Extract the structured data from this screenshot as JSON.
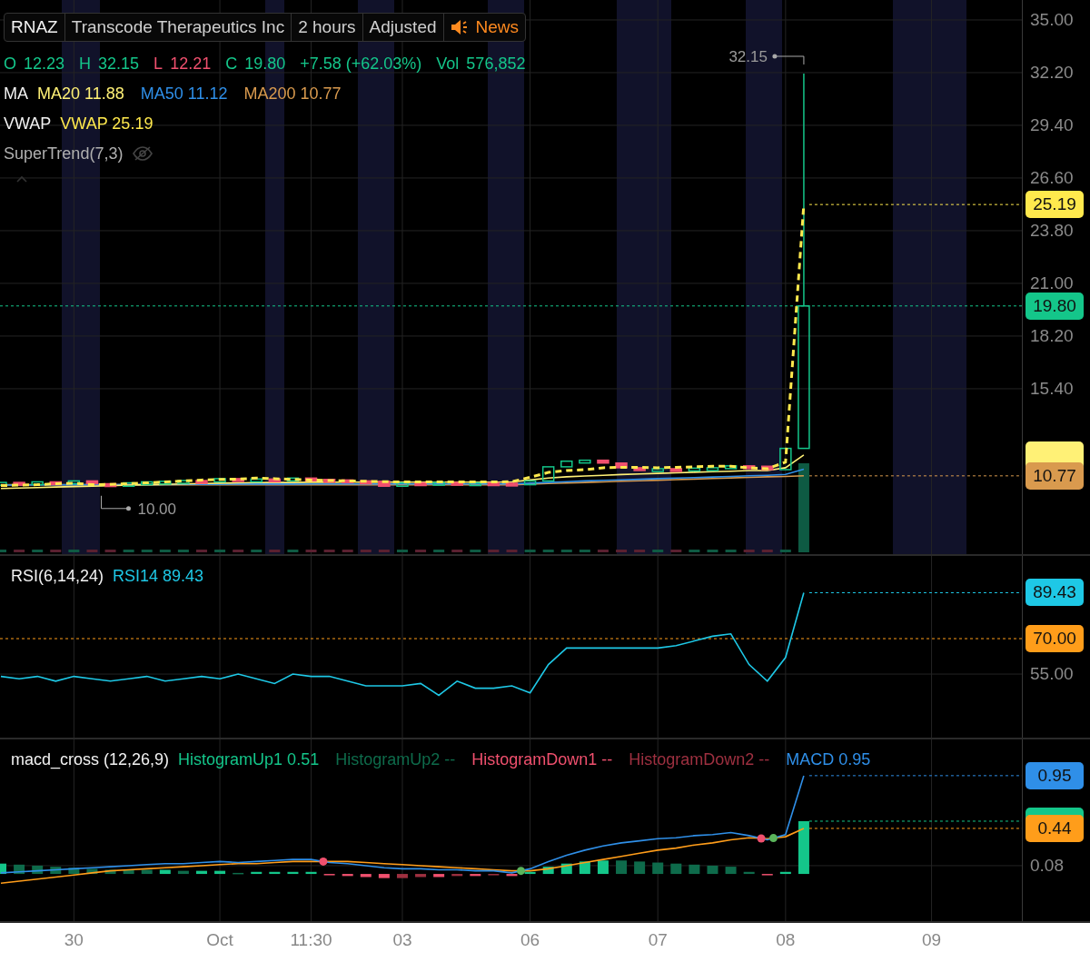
{
  "header": {
    "symbol": "RNAZ",
    "name": "Transcode Therapeutics Inc",
    "interval": "2 hours",
    "adjustment": "Adjusted",
    "news": "News"
  },
  "quote": [
    {
      "label": "O",
      "value": "12.23",
      "color": "#14c68a"
    },
    {
      "label": "H",
      "value": "32.15",
      "color": "#14c68a"
    },
    {
      "label": "L",
      "value": "12.21",
      "color": "#f0506e"
    },
    {
      "label": "C",
      "value": "19.80",
      "color": "#14c68a"
    },
    {
      "value": "+7.58 (+62.03%)",
      "color": "#14c68a"
    },
    {
      "label": "Vol",
      "value": "576,852",
      "color": "#14c68a"
    }
  ],
  "studies": [
    {
      "name": "MA",
      "visible": true,
      "values": [
        {
          "text": "MA20 11.88",
          "color": "#fff176"
        },
        {
          "text": "MA50 11.12",
          "color": "#2f8fe8"
        },
        {
          "text": "MA200 10.77",
          "color": "#d99a4e"
        }
      ]
    },
    {
      "name": "VWAP",
      "visible": true,
      "values": [
        {
          "text": "VWAP 25.19",
          "color": "#ffe94d"
        }
      ]
    },
    {
      "name": "SuperTrend(7,3)",
      "visible": false
    }
  ],
  "price_pane": {
    "annotations": [
      "32.15",
      "10.00"
    ],
    "axis_labels": [
      "35.00",
      "32.20",
      "29.40",
      "26.60",
      "23.80",
      "21.00",
      "18.20",
      "15.40"
    ],
    "price_tags": [
      {
        "value": "25.19",
        "kind": "last",
        "color": "#ffe94d"
      },
      {
        "value": "19.80",
        "kind": "level",
        "color": "#14c68a"
      },
      {
        "value": "10.77",
        "kind": "last",
        "color": "#d99a4e"
      }
    ]
  },
  "rsi_pane": {
    "title": "RSI(6,14,24)",
    "legend": {
      "text": "RSI14 89.43",
      "color": "#1ec8e6"
    },
    "axis_labels": [
      "55.00"
    ],
    "tags": [
      {
        "value": "89.43",
        "kind": "last",
        "color": "#1ec8e6"
      },
      {
        "value": "70.00",
        "kind": "level",
        "color": "#ff9d1a"
      }
    ]
  },
  "macd_pane": {
    "title": "macd_cross (12,26,9)",
    "legend": [
      {
        "text": "HistogramUp1 0.51",
        "color": "#14c68a"
      },
      {
        "text": "HistogramUp2 --",
        "color": "#0e6b4b"
      },
      {
        "text": "HistogramDown1 --",
        "color": "#f0506e"
      },
      {
        "text": "HistogramDown2 --",
        "color": "#9e3040"
      },
      {
        "text": "MACD 0.95",
        "color": "#2f8fe8"
      }
    ],
    "axis_labels": [
      "0.08"
    ],
    "tags": [
      {
        "value": "0.95",
        "kind": "last",
        "color": "#2f8fe8"
      },
      {
        "value": "0.44",
        "kind": "last",
        "color": "#ff9d1a"
      }
    ]
  },
  "time_axis": [
    "30",
    "Oct",
    "11:30",
    "03",
    "06",
    "07",
    "08",
    "09"
  ]
}
